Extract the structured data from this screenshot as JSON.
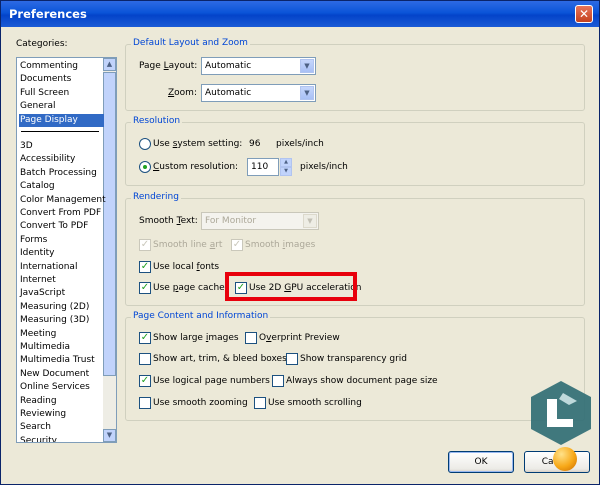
{
  "window": {
    "title": "Preferences",
    "close_glyph": "✕"
  },
  "categories": {
    "label": "Categories:",
    "items_top": [
      "Commenting",
      "Documents",
      "Full Screen",
      "General",
      "Page Display"
    ],
    "items_bottom": [
      "3D",
      "Accessibility",
      "Batch Processing",
      "Catalog",
      "Color Management",
      "Convert From PDF",
      "Convert To PDF",
      "Forms",
      "Identity",
      "International",
      "Internet",
      "JavaScript",
      "Measuring (2D)",
      "Measuring (3D)",
      "Meeting",
      "Multimedia",
      "Multimedia Trust",
      "New Document",
      "Online Services",
      "Reading",
      "Reviewing",
      "Search",
      "Security"
    ],
    "selected": "Page Display"
  },
  "layout_zoom": {
    "title": "Default Layout and Zoom",
    "page_layout_label_pre": "Page ",
    "page_layout_label_u": "L",
    "page_layout_label_post": "ayout:",
    "page_layout_value": "Automatic",
    "zoom_label_u": "Z",
    "zoom_label_post": "oom:",
    "zoom_value": "Automatic"
  },
  "resolution": {
    "title": "Resolution",
    "system_pre": "Use ",
    "system_u": "s",
    "system_post": "ystem setting:",
    "system_value": "96",
    "system_unit": "pixels/inch",
    "custom_u": "C",
    "custom_post": "ustom resolution:",
    "custom_value": "110",
    "custom_unit": "pixels/inch",
    "selected": "custom"
  },
  "rendering": {
    "title": "Rendering",
    "smooth_text_pre": "Smooth ",
    "smooth_text_u": "T",
    "smooth_text_post": "ext:",
    "smooth_text_value": "For Monitor",
    "smooth_line_art_pre": "Smooth line ",
    "smooth_line_art_u": "a",
    "smooth_line_art_post": "rt",
    "smooth_images_pre": "Smooth ",
    "smooth_images_u": "i",
    "smooth_images_post": "mages",
    "local_fonts_pre": "Use local ",
    "local_fonts_u": "f",
    "local_fonts_post": "onts",
    "page_cache_pre": "Use ",
    "page_cache_u": "p",
    "page_cache_post": "age cache",
    "gpu_pre": "Use 2D ",
    "gpu_u": "G",
    "gpu_post": "PU acceleration"
  },
  "page_content": {
    "title": "Page Content and Information",
    "large_images_pre": "Show large ",
    "large_images_u": "i",
    "large_images_post": "mages",
    "overprint_pre": "O",
    "overprint_u": "v",
    "overprint_post": "erprint Preview",
    "art_trim": "Show art, trim, & bleed boxes",
    "transparency": "Show transparency grid",
    "logical_numbers": "Use logical page numbers",
    "always_size": "Always show document page size",
    "smooth_zoom": "Use smooth zooming",
    "smooth_scroll": "Use smooth scrolling"
  },
  "buttons": {
    "ok": "OK",
    "cancel": "Cancel"
  },
  "check_glyph": "✓",
  "arrow_down": "▼",
  "arrow_up": "▲",
  "accent_colors": {
    "highlight": "#E8000C",
    "title_bar": "#0A54D8",
    "group_title": "#0046D5"
  }
}
